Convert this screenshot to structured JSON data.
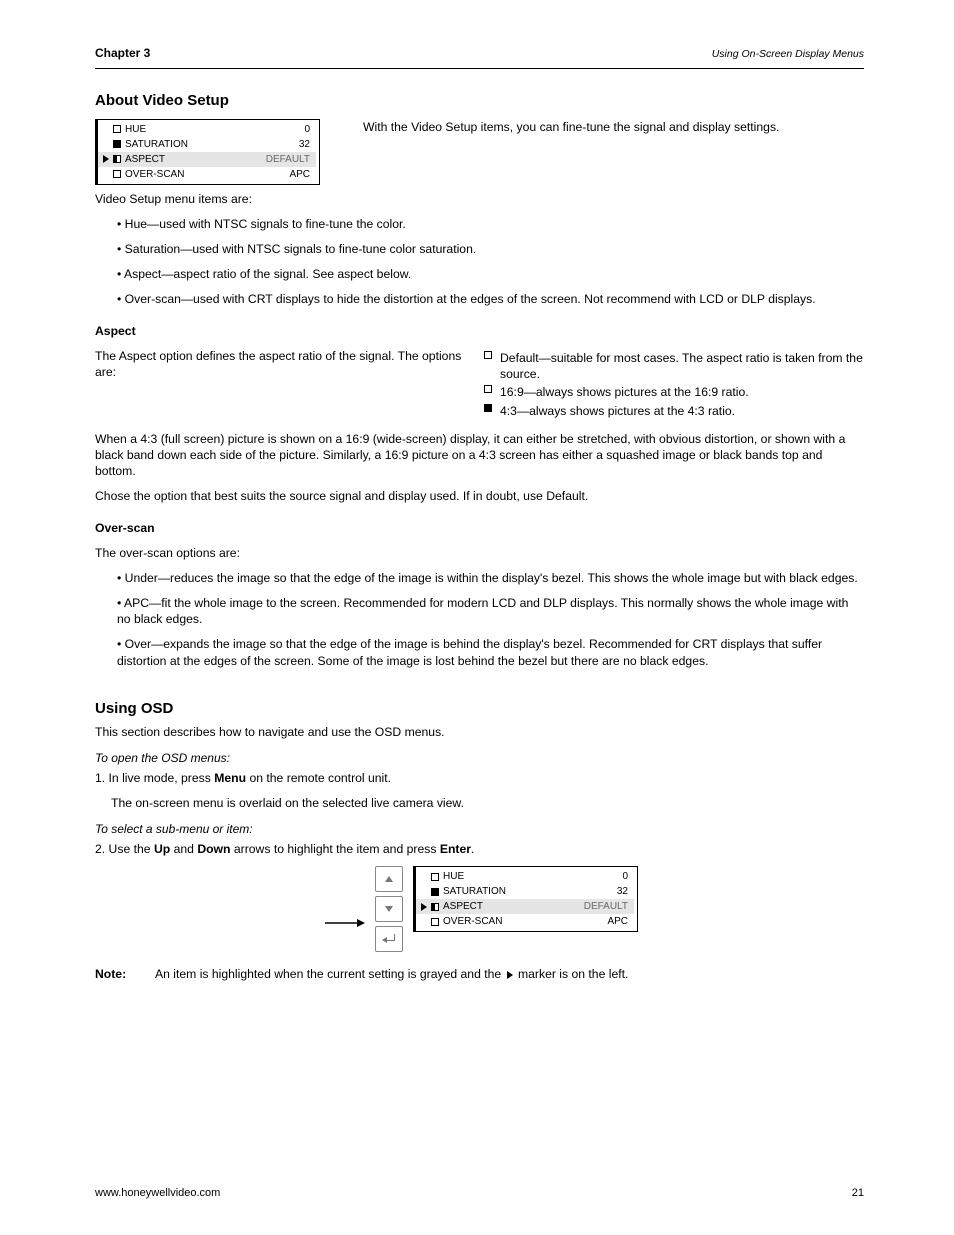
{
  "header": {
    "chapter": "Chapter 3",
    "subtitle": "Using On-Screen Display Menus"
  },
  "section1": {
    "title": "About Video Setup",
    "intro": "With the Video Setup items, you can fine-tune the signal and display settings.",
    "menu": {
      "items": [
        {
          "icon": "empty",
          "label": "HUE",
          "value": "0",
          "selected": false
        },
        {
          "icon": "filled",
          "label": "SATURATION",
          "value": "32",
          "selected": false
        },
        {
          "icon": "half",
          "label": "ASPECT",
          "value": "DEFAULT",
          "selected": true
        },
        {
          "icon": "empty",
          "label": "OVER-SCAN",
          "value": "APC",
          "selected": false
        }
      ]
    },
    "items_intro": "Video Setup menu items are:",
    "bullets": [
      "Hue—used with NTSC signals to fine-tune the color.",
      "Saturation—used with NTSC signals to fine-tune color saturation.",
      "Aspect—aspect ratio of the signal. See aspect below.",
      "Over-scan—used with CRT displays to hide the distortion at the edges of the screen. Not recommend with LCD or DLP displays."
    ],
    "aspect_title": "Aspect",
    "aspect_intro": "The Aspect option defines the aspect ratio of the signal. The options are:",
    "aspect_options": [
      {
        "icon": "empty",
        "text": "Default—suitable for most cases. The aspect ratio is taken from the source."
      },
      {
        "icon": "empty",
        "text": "16:9—always shows pictures at the 16:9 ratio."
      },
      {
        "icon": "filled",
        "text": "4:3—always shows pictures at the 4:3 ratio."
      }
    ],
    "aspect_note": "When a 4:3 (full screen) picture is shown on a 16:9 (wide-screen) display, it can either be stretched, with obvious distortion, or shown with a black band down each side of the picture. Similarly, a 16:9 picture on a 4:3 screen has either a squashed image or black bands top and bottom.",
    "aspect_note2": "Chose the option that best suits the source signal and display used. If in doubt, use Default.",
    "overscan_title": "Over-scan",
    "overscan_intro": "The over-scan options are:",
    "overscan_options": [
      "Under—reduces the image so that the edge of the image is within the display's bezel. This shows the whole image but with black edges.",
      "APC—fit the whole image to the screen. Recommended for modern LCD and DLP displays. This normally shows the whole image with no black edges.",
      "Over—expands the image so that the edge of the image is behind the display's bezel. Recommended for CRT displays that suffer distortion at the edges of the screen. Some of the image is lost behind the bezel but there are no black edges."
    ]
  },
  "section2": {
    "title": "Using OSD",
    "intro": "This section describes how to navigate and use the OSD menus.",
    "sub1": "To open the OSD menus:",
    "step1a_prefix": "1. In live mode, press ",
    "step1a_key": "Menu",
    "step1a_suffix": " on the remote control unit.",
    "step1b": "The on-screen menu is overlaid on the selected live camera view.",
    "sub2": "To select a sub-menu or item:",
    "step2_prefix": "2. Use the ",
    "step2_key1": "Up",
    "step2_and": " and ",
    "step2_key2": "Down",
    "step2_mid": " arrows to highlight the item and press ",
    "step2_key3": "Enter",
    "step2_suffix": ".",
    "note_label": "Note:",
    "note_text_1": "An item is highlighted when the current setting is grayed and the ",
    "note_text_2": " marker is on the left.",
    "menu2": {
      "items": [
        {
          "icon": "empty",
          "label": "HUE",
          "value": "0",
          "selected": false
        },
        {
          "icon": "filled",
          "label": "SATURATION",
          "value": "32",
          "selected": false
        },
        {
          "icon": "half",
          "label": "ASPECT",
          "value": "DEFAULT",
          "selected": true
        },
        {
          "icon": "empty",
          "label": "OVER-SCAN",
          "value": "APC",
          "selected": false
        }
      ]
    }
  },
  "footer": {
    "left": "www.honeywellvideo.com",
    "right": "21"
  }
}
